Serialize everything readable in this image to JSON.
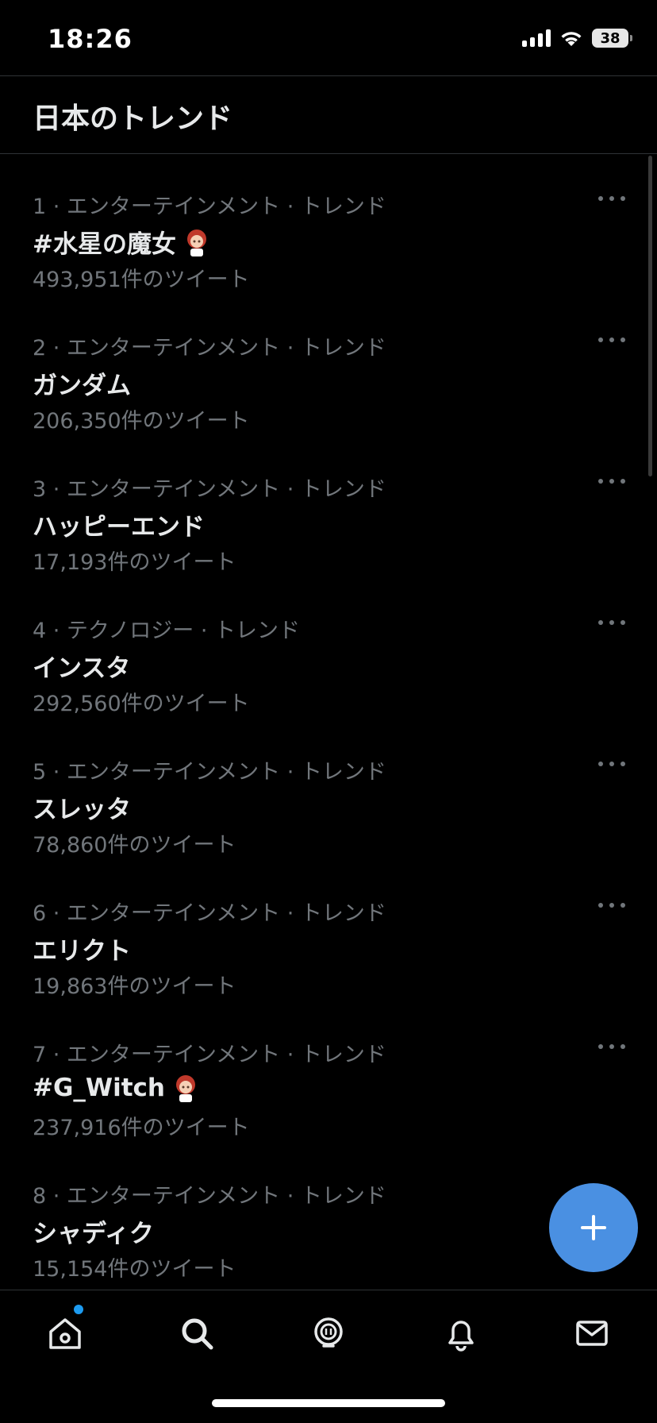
{
  "status": {
    "time": "18:26",
    "battery": "38"
  },
  "header": {
    "title": "日本のトレンド"
  },
  "trends": [
    {
      "meta": "1 · エンターテインメント · トレンド",
      "name": "#水星の魔女",
      "count": "493,951件のツイート",
      "emoji": true
    },
    {
      "meta": "2 · エンターテインメント · トレンド",
      "name": "ガンダム",
      "count": "206,350件のツイート",
      "emoji": false
    },
    {
      "meta": "3 · エンターテインメント · トレンド",
      "name": "ハッピーエンド",
      "count": "17,193件のツイート",
      "emoji": false
    },
    {
      "meta": "4 · テクノロジー · トレンド",
      "name": "インスタ",
      "count": "292,560件のツイート",
      "emoji": false
    },
    {
      "meta": "5 · エンターテインメント · トレンド",
      "name": "スレッタ",
      "count": "78,860件のツイート",
      "emoji": false
    },
    {
      "meta": "6 · エンターテインメント · トレンド",
      "name": "エリクト",
      "count": "19,863件のツイート",
      "emoji": false
    },
    {
      "meta": "7 · エンターテインメント · トレンド",
      "name": "#G_Witch",
      "count": "237,916件のツイート",
      "emoji": true
    },
    {
      "meta": "8 · エンターテインメント · トレンド",
      "name": "シャディク",
      "count": "15,154件のツイート",
      "emoji": false
    }
  ],
  "icons": {
    "fab": "plus-icon",
    "tabs": [
      "home-icon",
      "search-icon",
      "spaces-icon",
      "notifications-icon",
      "messages-icon"
    ]
  },
  "colors": {
    "accent": "#4a90e2",
    "muted": "#71767b",
    "text": "#e7e9ea"
  }
}
